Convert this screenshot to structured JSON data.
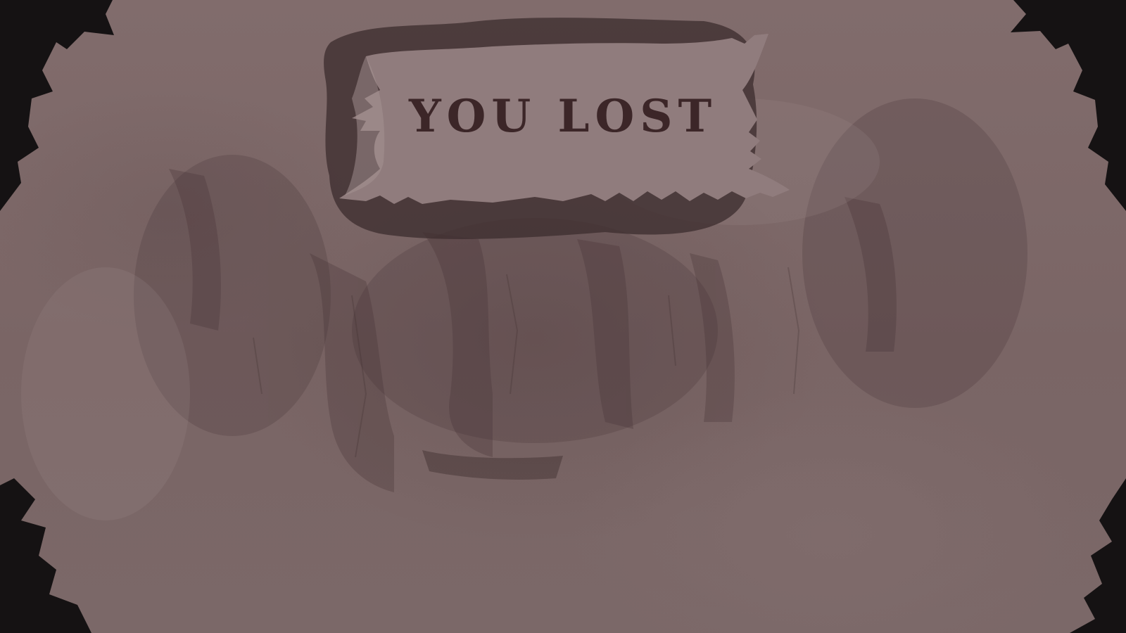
{
  "game_over": {
    "title": "YOU LOST"
  },
  "colors": {
    "background": "#7c6767",
    "banner": "#907c7d",
    "banner_stain": "#3e2e2f",
    "title_text": "#3c2628",
    "vignette": "#141012"
  },
  "icons": {
    "corners": "dark-foliage-silhouette"
  }
}
